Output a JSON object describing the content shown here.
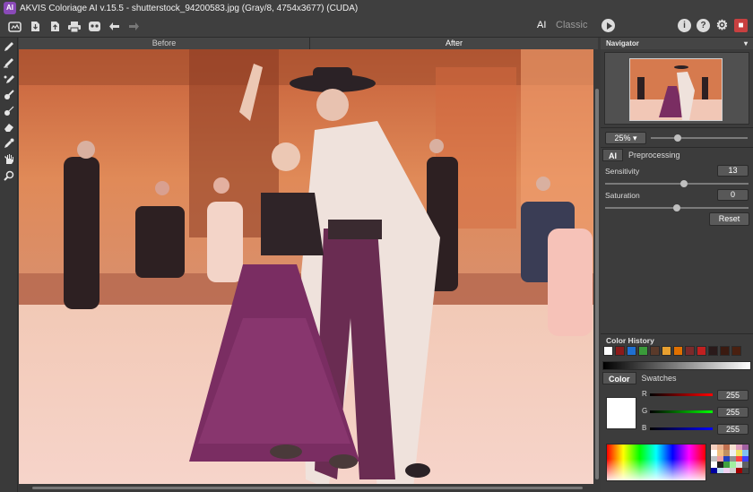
{
  "window": {
    "title": "AKVIS Coloriage AI v.15.5 - shutterstock_94200583.jpg (Gray/8, 4754x3677) (CUDA)",
    "logo_text": "AI"
  },
  "toolbar": {
    "icons": [
      "open-icon",
      "save-icon",
      "export-icon",
      "print-icon",
      "share-icon",
      "undo-icon",
      "redo-icon"
    ],
    "mode_ai": "AI",
    "mode_classic": "Classic",
    "right_icons": {
      "info": "i",
      "help": "?",
      "settings": "⚙",
      "book": "■"
    }
  },
  "view_tabs": {
    "before": "Before",
    "after": "After"
  },
  "navigator": {
    "title": "Navigator",
    "menu": "▾",
    "zoom": "25% ▾"
  },
  "settings_tabs": {
    "ai": "AI",
    "preprocessing": "Preprocessing"
  },
  "params": {
    "sensitivity_label": "Sensitivity",
    "sensitivity": "13",
    "sensitivity_level": 0.55,
    "saturation_label": "Saturation",
    "saturation": "0",
    "saturation_level": 0.5
  },
  "reset": "Reset",
  "color_history": {
    "label": "Color History",
    "swatches": [
      "#ffffff",
      "#8b1a1a",
      "#1f6fd1",
      "#3a9a3a",
      "#5a3a2a",
      "#e8a030",
      "#e07000",
      "#7a2a2a",
      "#c02020",
      "#2a1a1a",
      "#3a1a10",
      "#4a2010"
    ]
  },
  "color_tabs": {
    "color": "Color",
    "swatches": "Swatches"
  },
  "rgb": {
    "r_label": "R",
    "r": "255",
    "g_label": "G",
    "g": "255",
    "b_label": "B",
    "b": "255"
  },
  "colors": {
    "accent": "#c84040",
    "panel": "#3c3c3c"
  }
}
